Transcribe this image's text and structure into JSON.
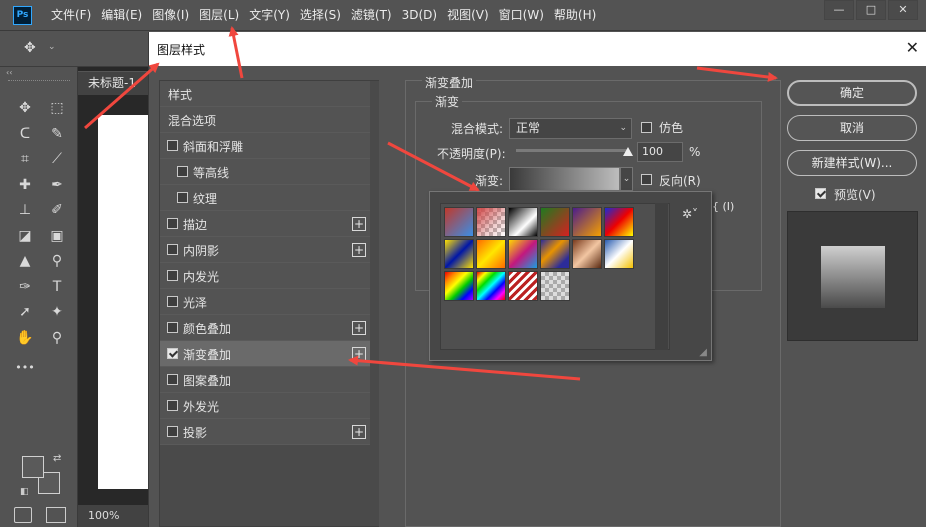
{
  "app": {
    "logo": "Ps",
    "menu": [
      "文件(F)",
      "编辑(E)",
      "图像(I)",
      "图层(L)",
      "文字(Y)",
      "选择(S)",
      "滤镜(T)",
      "3D(D)",
      "视图(V)",
      "窗口(W)",
      "帮助(H)"
    ],
    "window_controls": [
      "—",
      "□",
      "✕"
    ]
  },
  "options_bar": {
    "tool_icon": "move-icon"
  },
  "toolbar": {
    "collapse": "‹‹",
    "tools": [
      {
        "name": "move-icon",
        "glyph": "✥"
      },
      {
        "name": "marquee-icon",
        "glyph": "⬚"
      },
      {
        "name": "lasso-icon",
        "glyph": "ᑕ"
      },
      {
        "name": "quick-select-icon",
        "glyph": "✎"
      },
      {
        "name": "crop-icon",
        "glyph": "⌗"
      },
      {
        "name": "eyedropper-icon",
        "glyph": "⟋"
      },
      {
        "name": "healing-icon",
        "glyph": "✚"
      },
      {
        "name": "brush-icon",
        "glyph": "✒"
      },
      {
        "name": "stamp-icon",
        "glyph": "⊥"
      },
      {
        "name": "history-brush-icon",
        "glyph": "✐"
      },
      {
        "name": "eraser-icon",
        "glyph": "◪"
      },
      {
        "name": "gradient-tool-icon",
        "glyph": "▣"
      },
      {
        "name": "blur-icon",
        "glyph": "▲"
      },
      {
        "name": "dodge-icon",
        "glyph": "⚲"
      },
      {
        "name": "pen-icon",
        "glyph": "✑"
      },
      {
        "name": "type-icon",
        "glyph": "T"
      },
      {
        "name": "path-select-icon",
        "glyph": "➚"
      },
      {
        "name": "shape-icon",
        "glyph": "✦"
      },
      {
        "name": "hand-icon",
        "glyph": "✋"
      },
      {
        "name": "zoom-icon",
        "glyph": "⚲"
      }
    ],
    "more": "•••"
  },
  "document": {
    "tab_title": "未标题-1",
    "zoom": "100%"
  },
  "dialog": {
    "title": "图层样式",
    "close": "✕",
    "style_list": [
      {
        "label": "样式",
        "type": "header"
      },
      {
        "label": "混合选项",
        "type": "header"
      },
      {
        "label": "斜面和浮雕",
        "checked": false,
        "indent": 0,
        "add": false
      },
      {
        "label": "等高线",
        "checked": false,
        "indent": 1,
        "add": false
      },
      {
        "label": "纹理",
        "checked": false,
        "indent": 1,
        "add": false
      },
      {
        "label": "描边",
        "checked": false,
        "indent": 0,
        "add": true
      },
      {
        "label": "内阴影",
        "checked": false,
        "indent": 0,
        "add": true
      },
      {
        "label": "内发光",
        "checked": false,
        "indent": 0,
        "add": false
      },
      {
        "label": "光泽",
        "checked": false,
        "indent": 0,
        "add": false
      },
      {
        "label": "颜色叠加",
        "checked": false,
        "indent": 0,
        "add": true
      },
      {
        "label": "渐变叠加",
        "checked": true,
        "indent": 0,
        "add": true,
        "active": true
      },
      {
        "label": "图案叠加",
        "checked": false,
        "indent": 0,
        "add": false
      },
      {
        "label": "外发光",
        "checked": false,
        "indent": 0,
        "add": false
      },
      {
        "label": "投影",
        "checked": false,
        "indent": 0,
        "add": true
      }
    ],
    "settings": {
      "section_title": "渐变叠加",
      "group_title": "渐变",
      "blend_mode_label": "混合模式:",
      "blend_mode_value": "正常",
      "dither_label": "仿色",
      "opacity_label": "不透明度(P):",
      "opacity_value": "100",
      "opacity_unit": "%",
      "opacity_level": 1.0,
      "gradient_label": "渐变:",
      "reverse_label": "反向(R)",
      "stray_fragment": "{ (I)"
    },
    "buttons": {
      "ok": "确定",
      "cancel": "取消",
      "new_style": "新建样式(W)...",
      "preview_label": "预览(V)"
    }
  },
  "gradient_picker": {
    "gear": "✲˅",
    "presets": [
      "linear-gradient(135deg,#c0392b,#3a8ee6)",
      "linear-gradient(135deg,#d04848 0%,rgba(200,80,80,0.3) 60%,transparent),repeating-conic-gradient(#bbb 0 25%,#fff 0 50%) 0 0/8px 8px",
      "linear-gradient(135deg,#000,#fff 60%,#000)",
      "linear-gradient(135deg,#1f7a1f,#d62020)",
      "linear-gradient(135deg,#4b1d8c,#f5a000)",
      "linear-gradient(135deg,#1a2bd6,#e00 50%,#ff0)",
      "linear-gradient(135deg,#ffe100,#0016a8 50%,#ffe100)",
      "linear-gradient(135deg,#ff6a00,#ffe600 50%,#ff6a00)",
      "linear-gradient(135deg,#ffd800,#c2187e 50%,#1a9de0)",
      "linear-gradient(135deg,#2c2c9a,#e89300 40%,#2c2c9a 80%)",
      "linear-gradient(135deg,#7a3b1e,#f2c6a2 50%,#5a2a12)",
      "linear-gradient(135deg,#2a5db0,#fff 50%,#f4c000)",
      "linear-gradient(135deg,#e00,#f80,#ff0,#0c0,#00f,#a0f)",
      "linear-gradient(135deg,#e00,#ff0,#0d0,#0ff,#00f,#f0f,#e00)",
      "repeating-linear-gradient(135deg,#b22 0 3px,#fff 3px 6px)",
      "repeating-conic-gradient(#aaa 0 25%,#ddd 0 50%) 0 0/8px 8px"
    ]
  },
  "colors": {
    "accent_arrow": "#f0473e",
    "ps_logo_blue": "#31a8ff"
  }
}
